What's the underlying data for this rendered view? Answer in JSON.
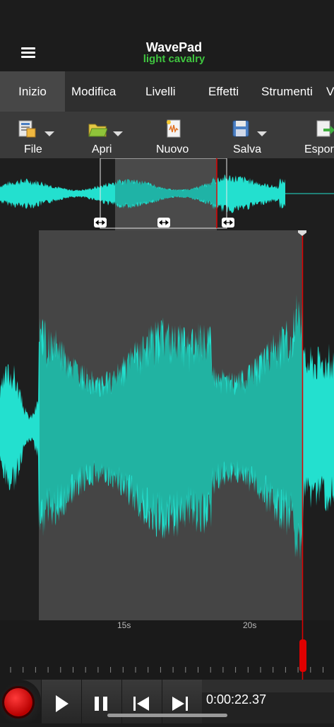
{
  "header": {
    "title": "WavePad",
    "subtitle": "light cavalry"
  },
  "tabs": [
    {
      "label": "Inizio",
      "active": true
    },
    {
      "label": "Modifica",
      "active": false
    },
    {
      "label": "Livelli",
      "active": false
    },
    {
      "label": "Effetti",
      "active": false
    },
    {
      "label": "Strumenti",
      "active": false
    },
    {
      "label": "V",
      "active": false
    }
  ],
  "toolbar": [
    {
      "label": "File",
      "icon": "file-icon",
      "dropdown": true
    },
    {
      "label": "Apri",
      "icon": "open-folder-icon",
      "dropdown": true
    },
    {
      "label": "Nuovo",
      "icon": "new-document-icon",
      "dropdown": false
    },
    {
      "label": "Salva",
      "icon": "save-disk-icon",
      "dropdown": true
    },
    {
      "label": "Espor",
      "icon": "export-icon",
      "dropdown": false
    }
  ],
  "timeline": {
    "labels": [
      "15s",
      "20s"
    ]
  },
  "transport": {
    "time": "0:00:22.37"
  },
  "colors": {
    "waveform": "#23e0cf",
    "selection_waveform": "#21b3a2",
    "selection_bg": "#444444",
    "playhead": "#e00000",
    "subtitle": "#3fc43f"
  }
}
